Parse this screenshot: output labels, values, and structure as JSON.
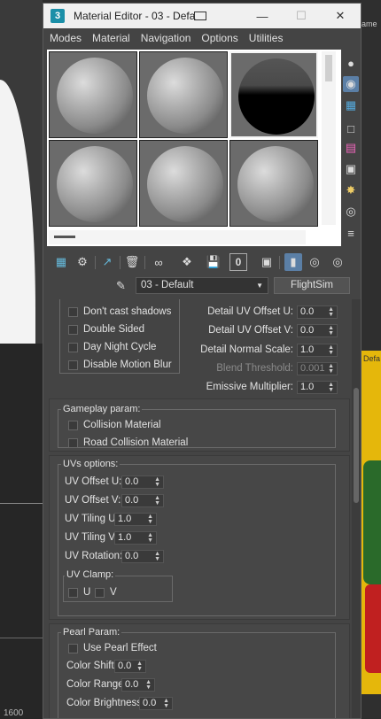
{
  "background": {
    "right_label": "ame",
    "left_number": "1600",
    "right_label2": "Defa"
  },
  "window": {
    "title": "Material Editor - 03 - Defa",
    "minimize_icon": "minimize-icon",
    "maximize_icon": "maximize-icon",
    "close_icon": "close-icon"
  },
  "menu": [
    "Modes",
    "Material",
    "Navigation",
    "Options",
    "Utilities"
  ],
  "material": {
    "name": "03 - Default",
    "type": "FlightSim"
  },
  "flags": {
    "items": [
      "Don't cast shadows",
      "Double Sided",
      "Day Night Cycle",
      "Disable Motion Blur"
    ]
  },
  "detail": {
    "uv_offset_u_label": "Detail UV Offset U:",
    "uv_offset_u": "0.0",
    "uv_offset_v_label": "Detail UV Offset V:",
    "uv_offset_v": "0.0",
    "normal_scale_label": "Detail Normal Scale:",
    "normal_scale": "1.0",
    "blend_threshold_label": "Blend Threshold:",
    "blend_threshold": "0.001",
    "emissive_label": "Emissive Multiplier:",
    "emissive": "1.0"
  },
  "gameplay": {
    "title": "Gameplay param:",
    "collision": "Collision Material",
    "road_collision": "Road Collision Material"
  },
  "uvs": {
    "title": "UVs options:",
    "offset_u_label": "UV Offset U:",
    "offset_u": "0.0",
    "offset_v_label": "UV Offset V:",
    "offset_v": "0.0",
    "tiling_u_label": "UV Tiling U:",
    "tiling_u": "1.0",
    "tiling_v_label": "UV Tiling V:",
    "tiling_v": "1.0",
    "rotation_label": "UV Rotation:",
    "rotation": "0.0",
    "clamp_title": "UV Clamp:",
    "clamp_u": "U",
    "clamp_v": "V"
  },
  "pearl": {
    "title": "Pearl Param:",
    "use": "Use Pearl Effect",
    "color_shift_label": "Color Shift",
    "color_shift": "0.0",
    "color_range_label": "Color Range",
    "color_range": "0.0",
    "color_brightness_label": "Color Brightness",
    "color_brightness": "0.0"
  },
  "colors": {
    "accent": "#5b7fa6",
    "panel": "#474747",
    "app_icon": "#1b8fa8"
  }
}
